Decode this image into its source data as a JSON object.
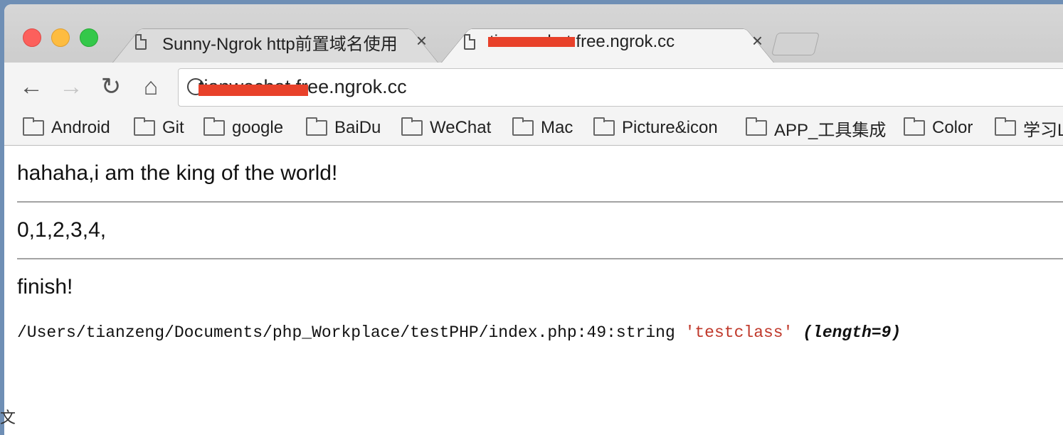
{
  "tabs": [
    {
      "title": "Sunny-Ngrok http前置域名使用",
      "close": "×"
    },
    {
      "title": "tianwechat.free.ngrok.cc",
      "close": "×"
    }
  ],
  "toolbar": {
    "back": "←",
    "forward": "→",
    "reload": "↻",
    "home": "⌂",
    "url": "tianwechat.free.ngrok.cc"
  },
  "bookmarks": [
    "Android",
    "Git",
    "google",
    "BaiDu",
    "WeChat",
    "Mac",
    "Picture&icon",
    "APP_工具集成",
    "Color",
    "学习L"
  ],
  "content": {
    "line1": "hahaha,i am the king of the world!",
    "line2": "0,1,2,3,4,",
    "line3": "finish!",
    "debug_path": "/Users/tianzeng/Documents/php_Workplace/testPHP/index.php:49:string",
    "debug_value": "'testclass'",
    "debug_meta": "(length=9)"
  },
  "edge_glyph": "文",
  "colors": {
    "redaction": "#e8412a",
    "string": "#c0392b"
  }
}
